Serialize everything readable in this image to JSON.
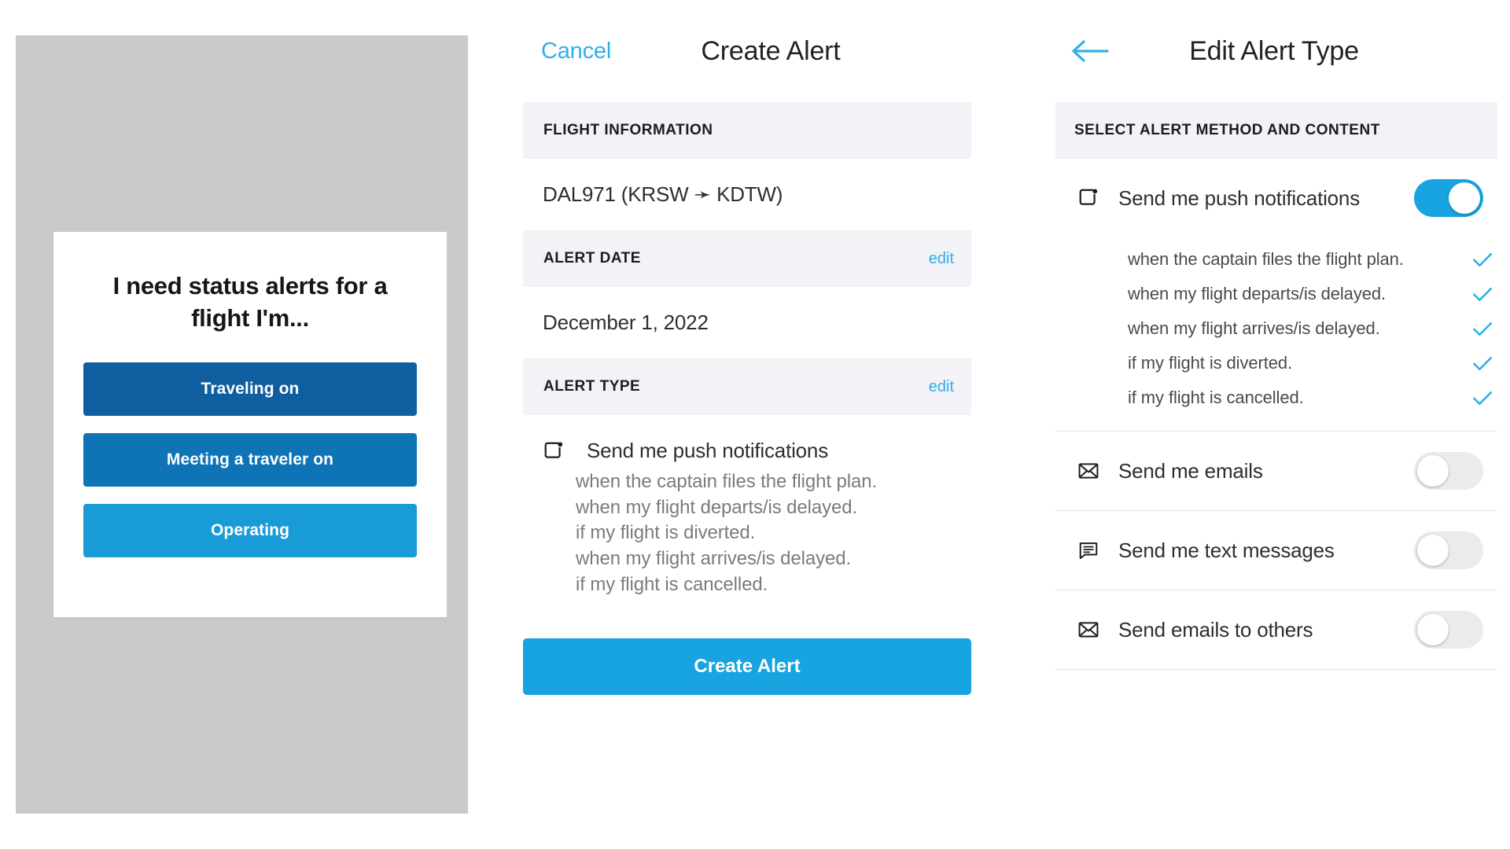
{
  "colors": {
    "accent": "#18a4e0",
    "link": "#2eb0e8",
    "dark_blue": "#0f5fa0",
    "mid_blue": "#0e74b6",
    "light_blue": "#189bd7",
    "section_bg": "#f2f2f7",
    "page_bg": "#c9c9c9",
    "muted_text": "#7b7b80",
    "toggle_off": "#eceaea"
  },
  "left_panel": {
    "modal": {
      "title": "I need status alerts for a flight I'm...",
      "buttons": [
        {
          "label": "Traveling on",
          "color": "#0f5fa0"
        },
        {
          "label": "Meeting a traveler on",
          "color": "#0e74b6"
        },
        {
          "label": "Operating",
          "color": "#189bd7"
        }
      ]
    }
  },
  "middle_panel": {
    "nav": {
      "cancel_label": "Cancel",
      "title": "Create Alert"
    },
    "sections": [
      {
        "heading": "FLIGHT INFORMATION",
        "edit_label": "",
        "value": "DAL971 (KRSW ➛ KDTW)"
      },
      {
        "heading": "ALERT DATE",
        "edit_label": "edit",
        "value": "December 1, 2022"
      },
      {
        "heading": "ALERT TYPE",
        "edit_label": "edit",
        "value": ""
      }
    ],
    "alert_type": {
      "method_icon": "push-notification-icon",
      "method_label": "Send me push notifications",
      "conditions": [
        "when the captain files the flight plan.",
        "when my flight departs/is delayed.",
        "if my flight is diverted.",
        "when my flight arrives/is delayed.",
        "if my flight is cancelled."
      ]
    },
    "submit_button": "Create Alert"
  },
  "right_panel": {
    "nav": {
      "back_icon": "arrow-left-icon",
      "title": "Edit Alert Type"
    },
    "section_heading": "SELECT ALERT METHOD AND CONTENT",
    "methods": [
      {
        "icon": "push-notification-icon",
        "label": "Send me push notifications",
        "toggle": "on",
        "conditions": [
          {
            "text": "when the captain files the flight plan.",
            "checked": true
          },
          {
            "text": "when my flight departs/is delayed.",
            "checked": true
          },
          {
            "text": "when my flight arrives/is delayed.",
            "checked": true
          },
          {
            "text": "if my flight is diverted.",
            "checked": true
          },
          {
            "text": "if my flight is cancelled.",
            "checked": true
          }
        ]
      },
      {
        "icon": "envelope-icon",
        "label": "Send me emails",
        "toggle": "off",
        "conditions": []
      },
      {
        "icon": "speech-bubble-icon",
        "label": "Send me text messages",
        "toggle": "off",
        "conditions": []
      },
      {
        "icon": "envelope-icon",
        "label": "Send emails to others",
        "toggle": "off",
        "conditions": []
      }
    ]
  }
}
